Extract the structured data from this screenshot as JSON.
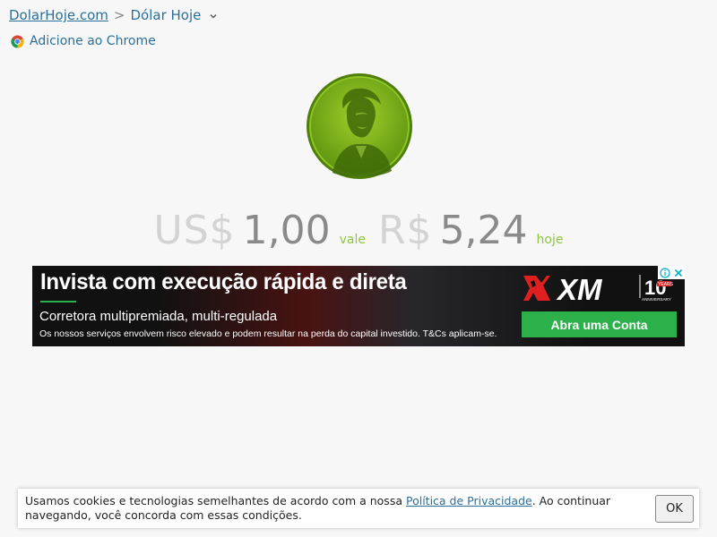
{
  "breadcrumb": {
    "home": "DolarHoje.com",
    "separator": ">",
    "current": "Dólar Hoje"
  },
  "chrome_link": "Adicione ao Chrome",
  "rate": {
    "from_currency": "US$",
    "from_value": "1,00",
    "connector": "vale",
    "to_currency": "R$",
    "to_value": "5,24",
    "suffix": "hoje"
  },
  "ad": {
    "headline": "Invista com execução rápida e direta",
    "subline": "Corretora multipremiada, multi-regulada",
    "disclaimer": "Os nossos serviços envolvem risco elevado e podem resultar na perda do capital investido. T&Cs aplicam-se.",
    "brand": "XM",
    "anniversary": "10",
    "anniversary_word": "YEARS",
    "anniversary_sub": "ANNIVERSARY",
    "cta": "Abra uma Conta"
  },
  "cookie": {
    "text_before": "Usamos cookies e tecnologias semelhantes de acordo com a nossa ",
    "link": "Política de Privacidade",
    "text_after": ". Ao continuar navegando, você concorda com essas condições.",
    "button": "OK"
  },
  "colors": {
    "link": "#2b6f99",
    "accent_green": "#8dc63f",
    "coin_green": "#7aad1c",
    "ad_green": "#2bb04a",
    "ad_red": "#e02020"
  }
}
